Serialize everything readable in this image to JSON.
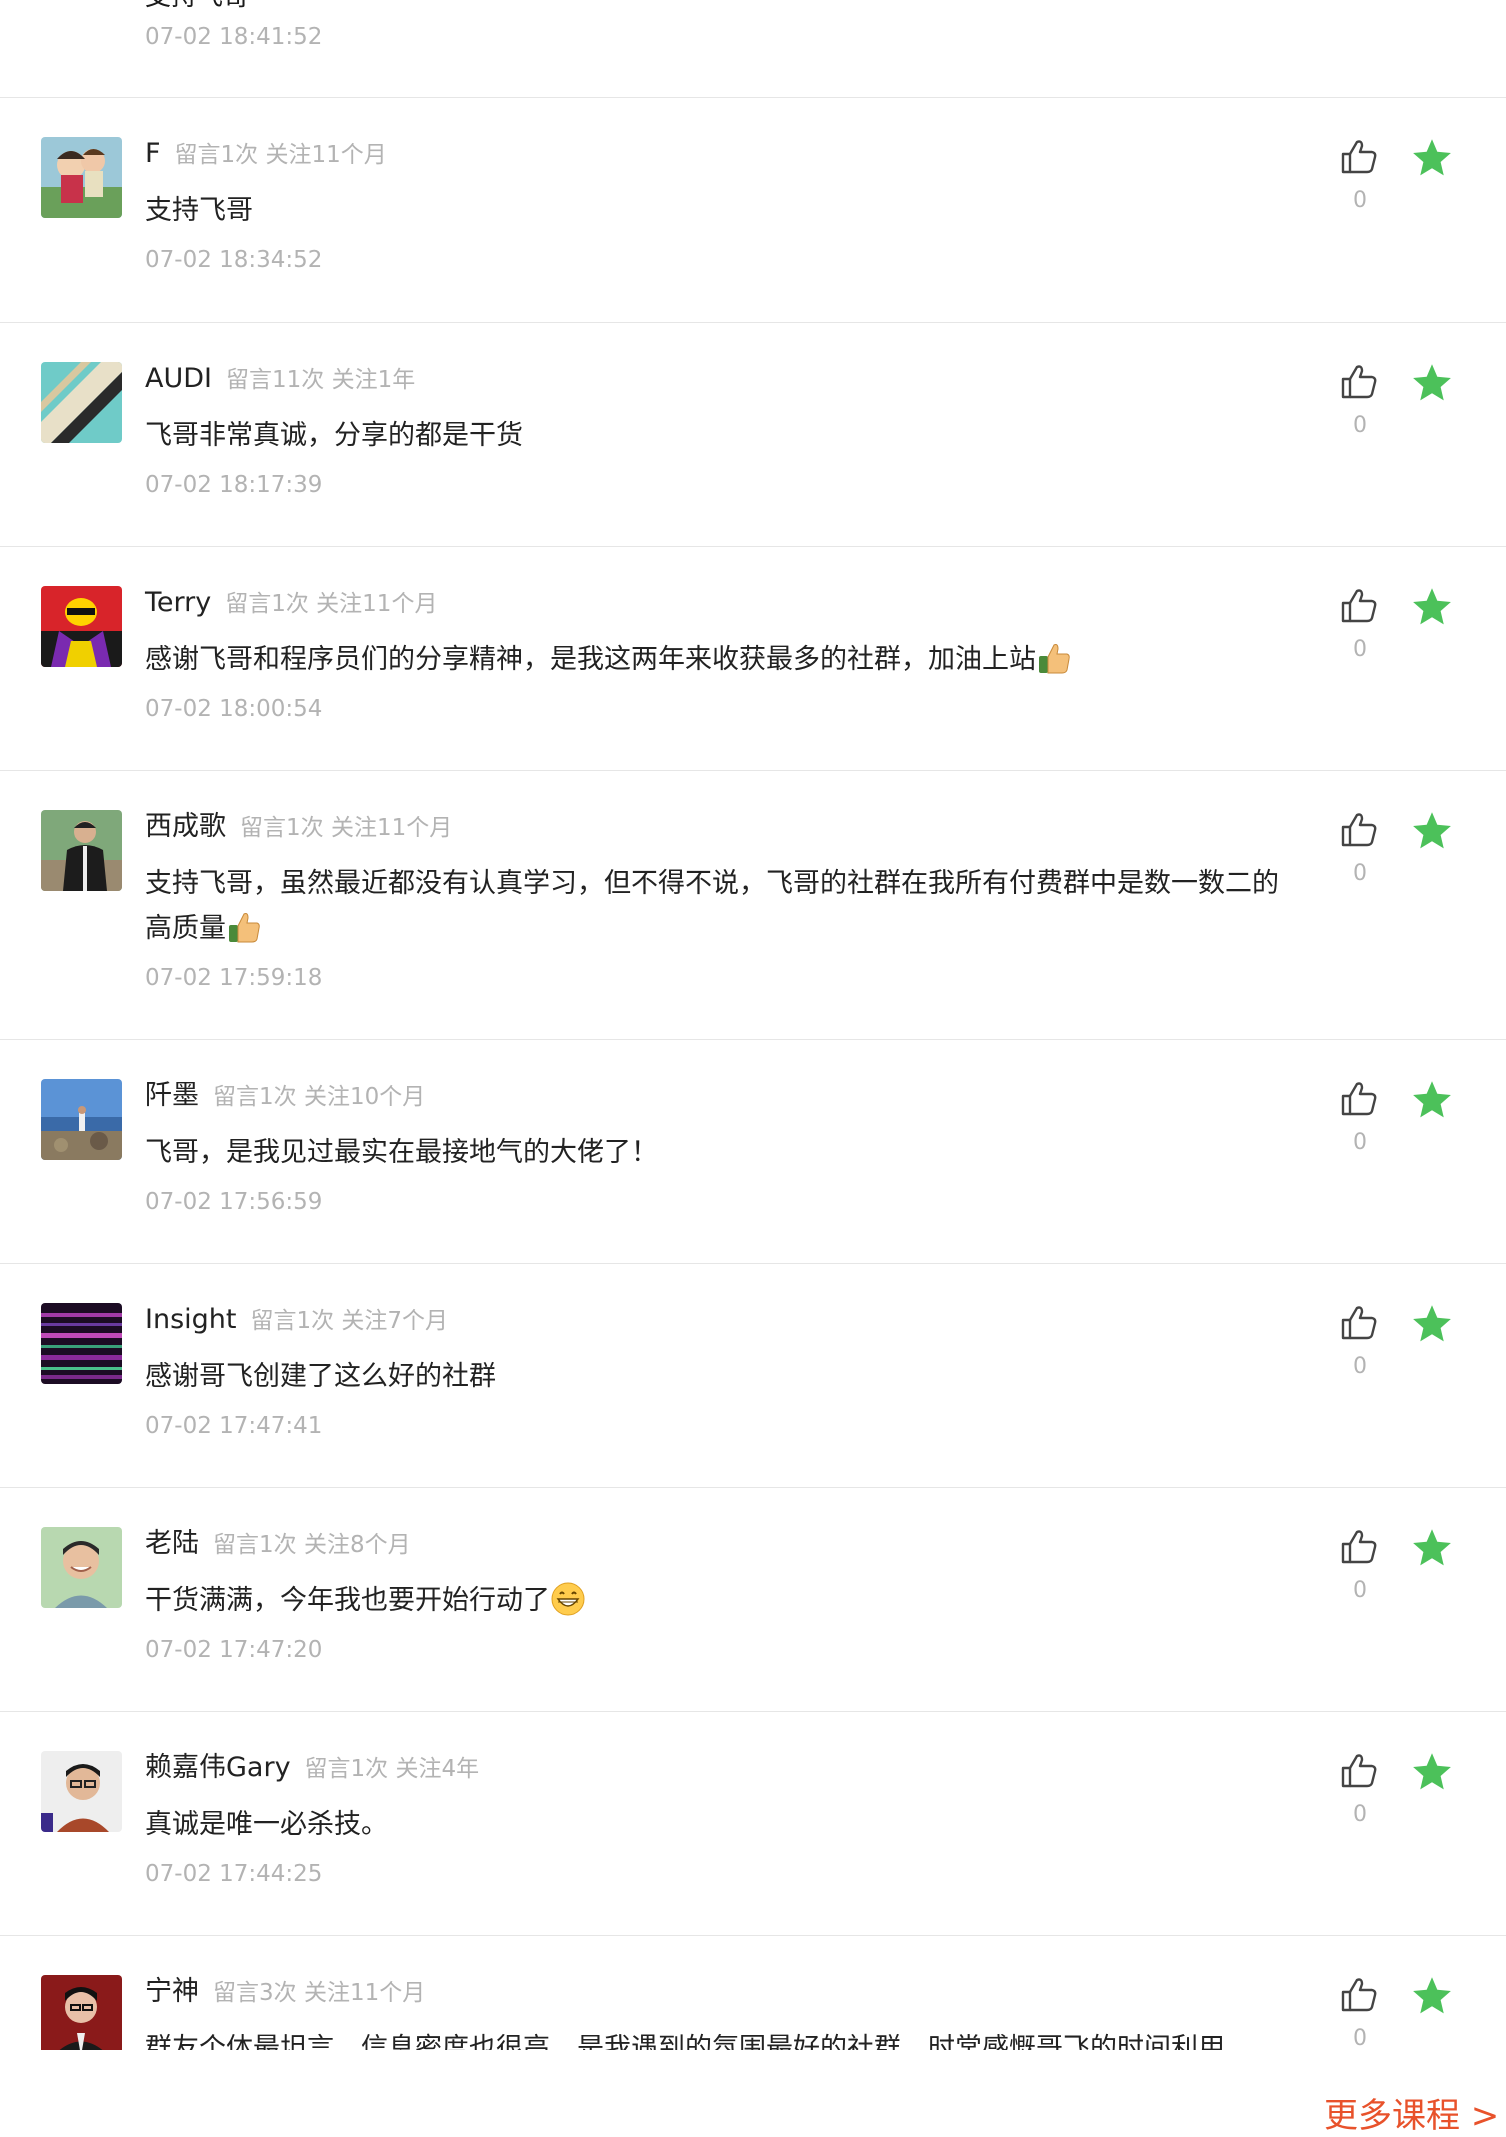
{
  "top_partial": {
    "text": "支持飞哥",
    "time": "07-02 18:41:52"
  },
  "comments": [
    {
      "name": "F",
      "meta": "留言1次 关注11个月",
      "text": "支持飞哥",
      "time": "07-02 18:34:52",
      "likes": "0"
    },
    {
      "name": "AUDI",
      "meta": "留言11次 关注1年",
      "text": "飞哥非常真诚，分享的都是干货",
      "time": "07-02 18:17:39",
      "likes": "0"
    },
    {
      "name": "Terry",
      "meta": "留言1次 关注11个月",
      "text": "感谢飞哥和程序员们的分享精神，是我这两年来收获最多的社群，加油上站",
      "time": "07-02 18:00:54",
      "likes": "0",
      "emoji": "thumbs-up"
    },
    {
      "name": "西成歌",
      "meta": "留言1次 关注11个月",
      "text": "支持飞哥，虽然最近都没有认真学习，但不得不说，飞哥的社群在我所有付费群中是数一数二的高质量",
      "time": "07-02 17:59:18",
      "likes": "0",
      "emoji": "thumbs-up"
    },
    {
      "name": "阡墨",
      "meta": "留言1次 关注10个月",
      "text": "飞哥，是我见过最实在最接地气的大佬了！",
      "time": "07-02 17:56:59",
      "likes": "0"
    },
    {
      "name": "Insight",
      "meta": "留言1次 关注7个月",
      "text": "感谢哥飞创建了这么好的社群",
      "time": "07-02 17:47:41",
      "likes": "0"
    },
    {
      "name": "老陆",
      "meta": "留言1次 关注8个月",
      "text": "干货满满，今年我也要开始行动了",
      "time": "07-02 17:47:20",
      "likes": "0",
      "emoji": "grin"
    },
    {
      "name": "赖嘉伟Gary",
      "meta": "留言1次 关注4年",
      "text": "真诚是唯一必杀技。",
      "time": "07-02 17:44:25",
      "likes": "0"
    },
    {
      "name": "宁神",
      "meta": "留言3次 关注11个月",
      "text": "群友个体最坦言，信息密度也很高，是我遇到的氛围最好的社群，时常感慨哥飞的时间利用",
      "time": "",
      "likes": "0"
    }
  ],
  "footer": {
    "more_label": "更多课程 >"
  },
  "colors": {
    "star": "#4cc15a",
    "meta": "#b3b3b3",
    "accent": "#e8522b"
  }
}
